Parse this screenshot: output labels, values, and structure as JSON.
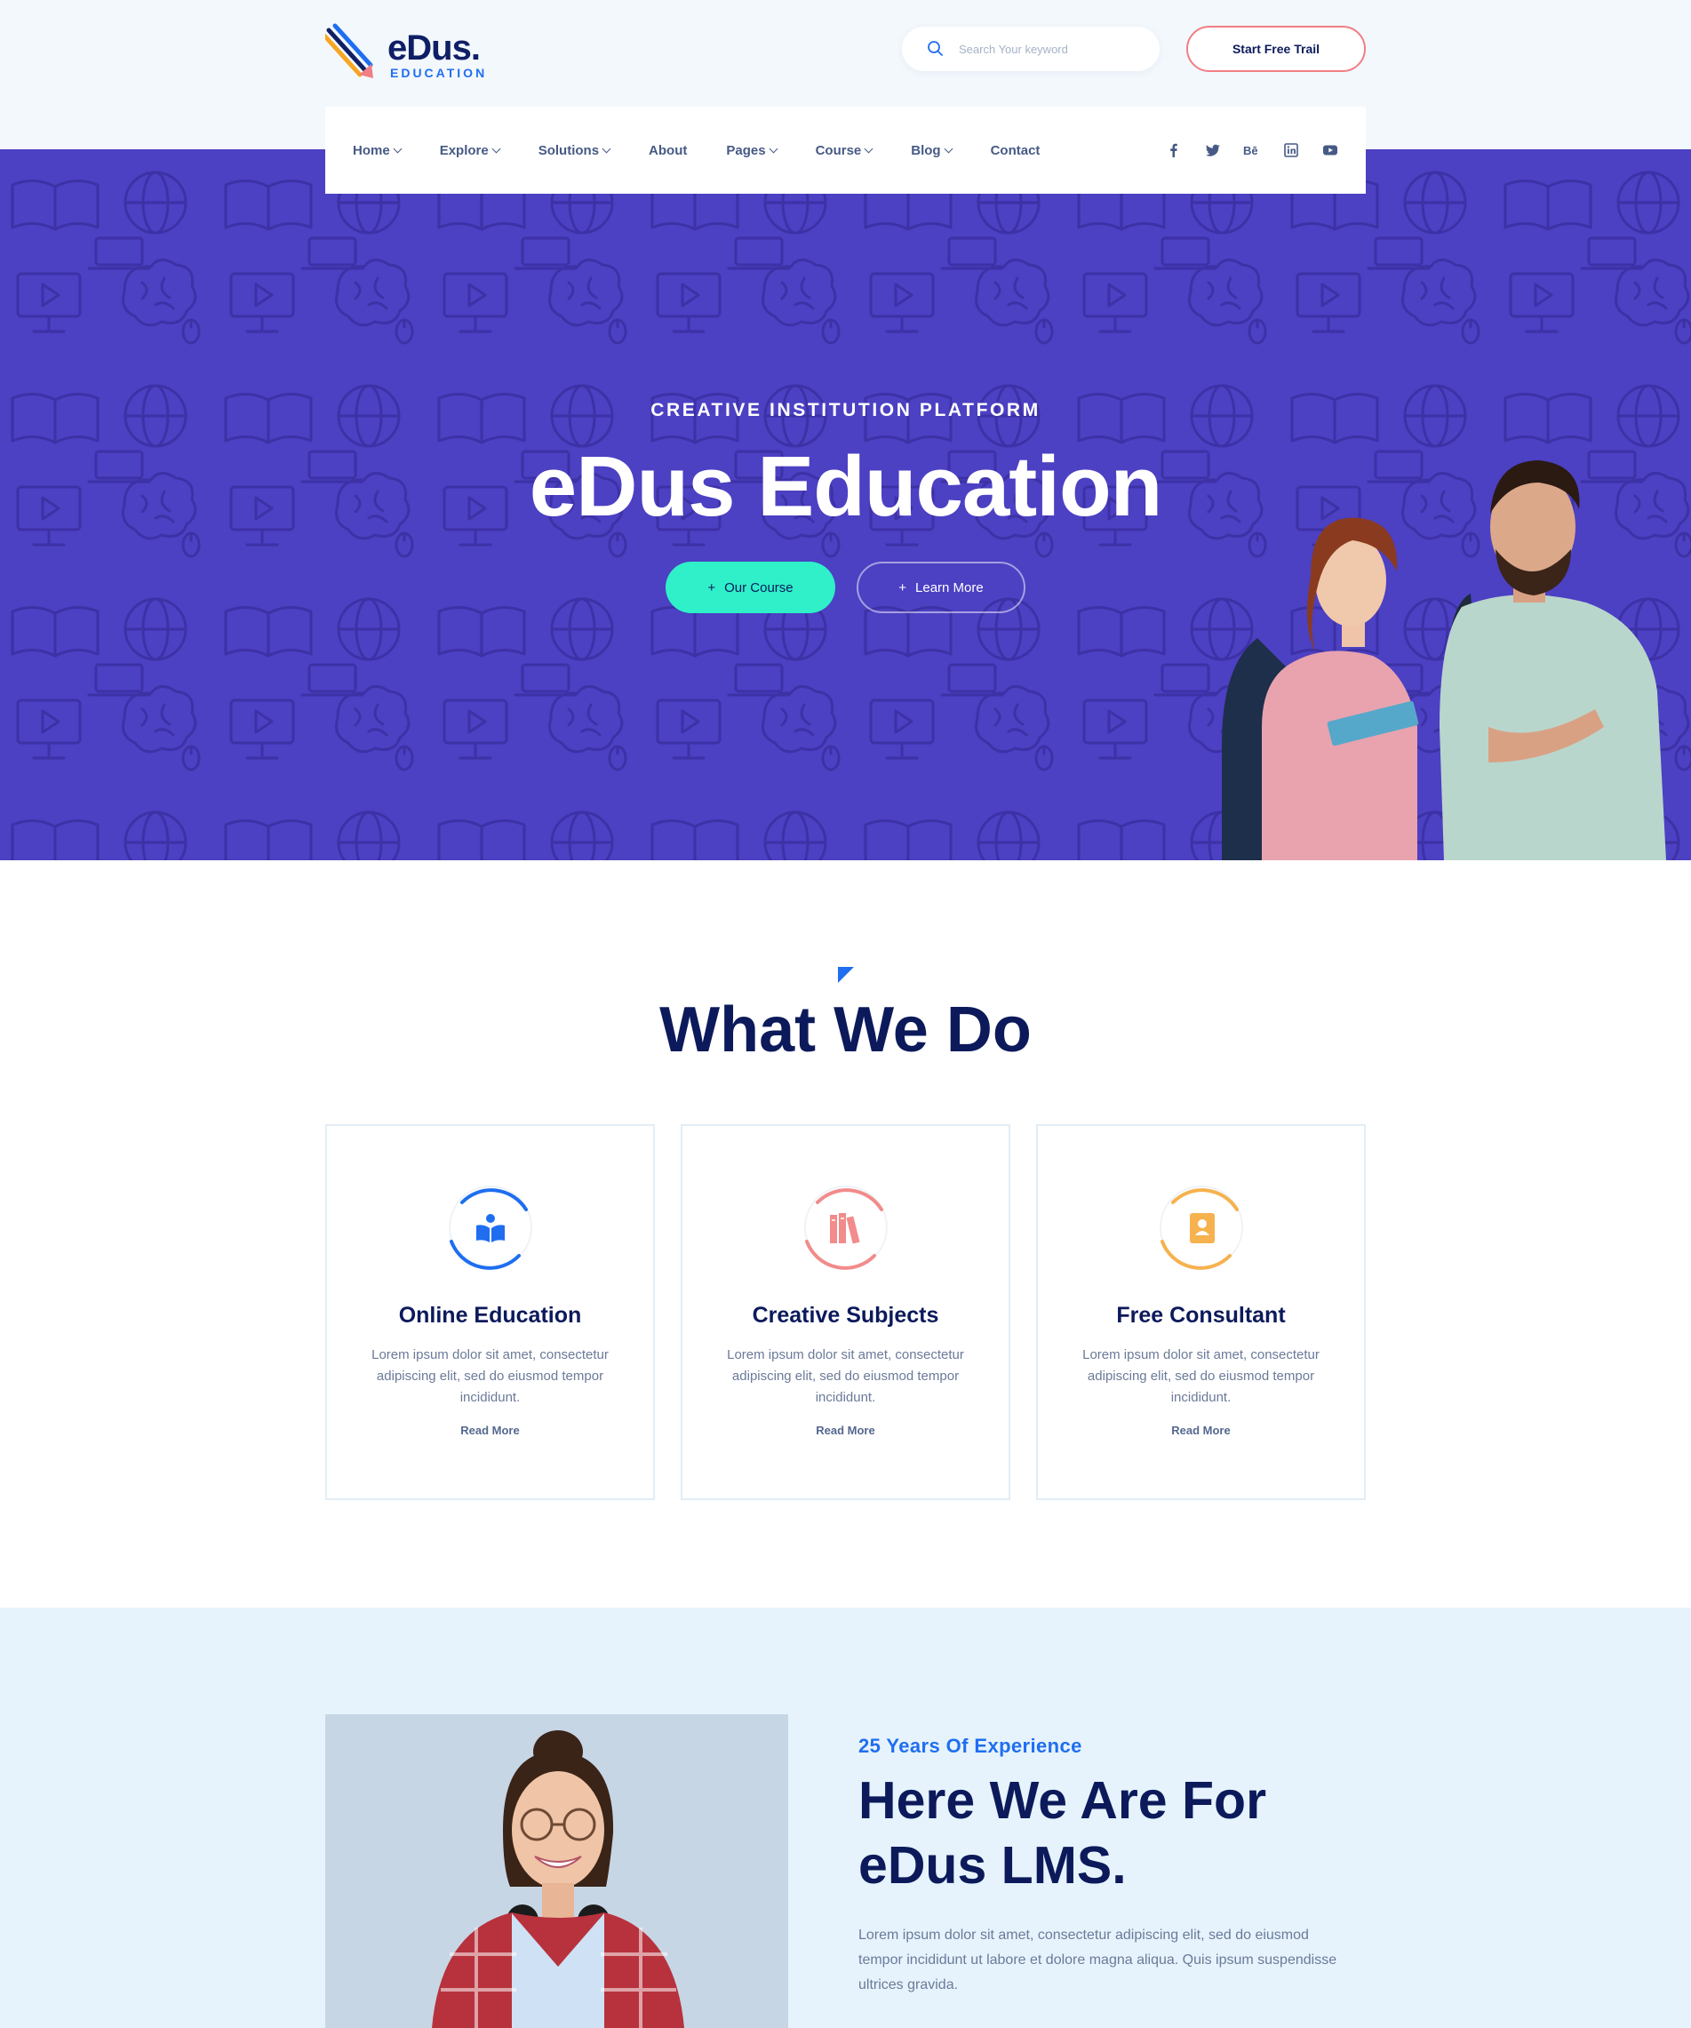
{
  "brand": {
    "name": "eDus.",
    "tagline": "EDUCATION"
  },
  "header": {
    "search_placeholder": "Search Your keyword",
    "cta_label": "Start Free Trail"
  },
  "nav": {
    "items": [
      {
        "label": "Home",
        "has_dropdown": true
      },
      {
        "label": "Explore",
        "has_dropdown": true
      },
      {
        "label": "Solutions",
        "has_dropdown": true
      },
      {
        "label": "About",
        "has_dropdown": false
      },
      {
        "label": "Pages",
        "has_dropdown": true
      },
      {
        "label": "Course",
        "has_dropdown": true
      },
      {
        "label": "Blog",
        "has_dropdown": true
      },
      {
        "label": "Contact",
        "has_dropdown": false
      }
    ],
    "socials": [
      "facebook-icon",
      "twitter-icon",
      "behance-icon",
      "linkedin-icon",
      "youtube-icon"
    ]
  },
  "hero": {
    "kicker": "CREATIVE INSTITUTION PLATFORM",
    "title": "eDus Education",
    "primary_button": "Our Course",
    "secondary_button": "Learn More",
    "background_color": "#4c40c3",
    "primary_button_color": "#2ff0c8"
  },
  "services": {
    "title": "What We Do",
    "cards": [
      {
        "title": "Online Education",
        "text": "Lorem ipsum dolor sit amet, consectetur adipiscing elit, sed do eiusmod tempor incididunt.",
        "link": "Read More",
        "icon": "reading-book-icon",
        "accent": "#1f6ef0"
      },
      {
        "title": "Creative Subjects",
        "text": "Lorem ipsum dolor sit amet, consectetur adipiscing elit, sed do eiusmod tempor incididunt.",
        "link": "Read More",
        "icon": "books-icon",
        "accent": "#f28b8b"
      },
      {
        "title": "Free Consultant",
        "text": "Lorem ipsum dolor sit amet, consectetur adipiscing elit, sed do eiusmod tempor incididunt.",
        "link": "Read More",
        "icon": "contact-book-icon",
        "accent": "#f6b24e"
      }
    ]
  },
  "about": {
    "kicker": "25 Years Of Experience",
    "title": "Here We Are For eDus LMS.",
    "text": "Lorem ipsum dolor sit amet, consectetur adipiscing elit, sed do eiusmod tempor incididunt ut labore et dolore magna aliqua. Quis ipsum suspendisse ultrices gravida."
  }
}
